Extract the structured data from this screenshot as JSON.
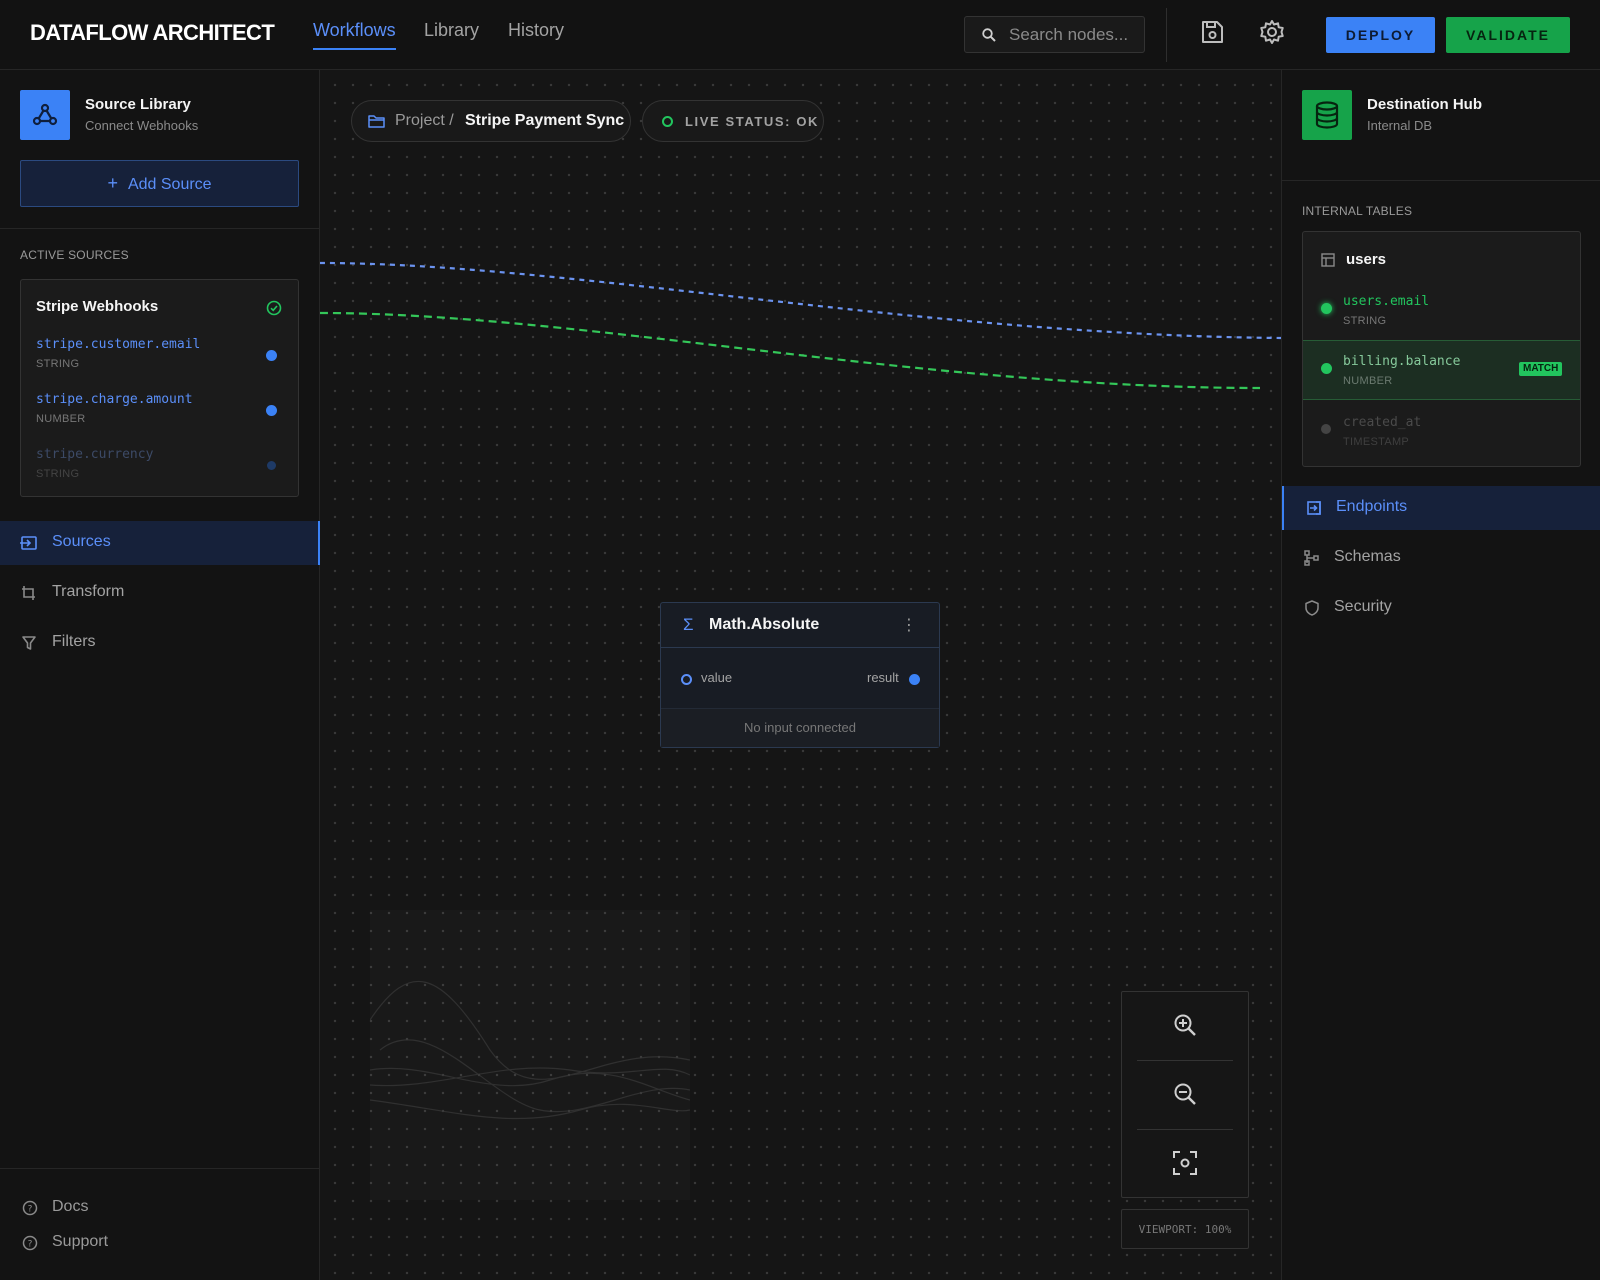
{
  "header": {
    "brand": "DATAFLOW ARCHITECT",
    "tabs": [
      {
        "label": "Workflows",
        "active": true
      },
      {
        "label": "Library",
        "active": false
      },
      {
        "label": "History",
        "active": false
      }
    ],
    "search": {
      "placeholder": "Search nodes..."
    },
    "icons": [
      "search-icon",
      "save-icon",
      "gear-icon"
    ],
    "deploy_label": "DEPLOY",
    "validate_label": "VALIDATE"
  },
  "left": {
    "library_title": "Source Library",
    "library_subtitle": "Connect Webhooks",
    "add_source_label": "Add Source",
    "active_sources_label": "ACTIVE SOURCES",
    "source": {
      "title": "Stripe Webhooks",
      "fields": [
        {
          "name": "stripe.customer.email",
          "type": "STRING"
        },
        {
          "name": "stripe.charge.amount",
          "type": "NUMBER"
        },
        {
          "name": "stripe.currency",
          "type": "STRING"
        }
      ]
    },
    "nav": [
      {
        "label": "Sources",
        "icon": "sources-icon",
        "active": true
      },
      {
        "label": "Transform",
        "icon": "transform-icon",
        "active": false
      },
      {
        "label": "Filters",
        "icon": "filter-icon",
        "active": false
      }
    ],
    "footer": [
      {
        "label": "Docs",
        "icon": "help-icon"
      },
      {
        "label": "Support",
        "icon": "support-icon"
      }
    ]
  },
  "canvas": {
    "breadcrumb_project": "Project /",
    "breadcrumb_name": "Stripe Payment Sync",
    "live_status": "LIVE STATUS: OK",
    "node": {
      "title": "Math.Absolute",
      "input_label": "value",
      "output_label": "result",
      "footer": "No input connected"
    },
    "viewport_label": "VIEWPORT: 100%"
  },
  "right": {
    "hub_title": "Destination Hub",
    "hub_subtitle": "Internal DB",
    "internal_tables_label": "INTERNAL TABLES",
    "table": {
      "name": "users",
      "columns": [
        {
          "name": "users.email",
          "type": "STRING",
          "state": "connected"
        },
        {
          "name": "billing.balance",
          "type": "NUMBER",
          "state": "match",
          "badge": "MATCH"
        },
        {
          "name": "created_at",
          "type": "TIMESTAMP",
          "state": "inactive"
        }
      ]
    },
    "nav": [
      {
        "label": "Endpoints",
        "icon": "endpoints-icon",
        "active": true
      },
      {
        "label": "Schemas",
        "icon": "schema-icon",
        "active": false
      },
      {
        "label": "Security",
        "icon": "shield-icon",
        "active": false
      }
    ]
  },
  "colors": {
    "accent_blue": "#3b82f6",
    "accent_green": "#22c55e",
    "background": "#121212"
  }
}
